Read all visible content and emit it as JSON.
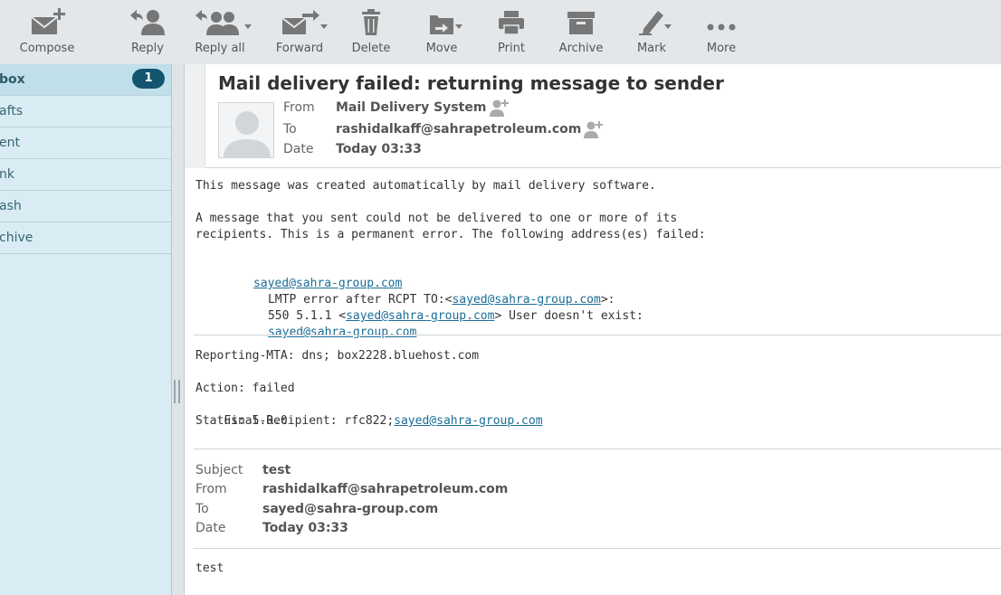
{
  "toolbar": {
    "compose": "Compose",
    "reply": "Reply",
    "reply_all": "Reply all",
    "forward": "Forward",
    "delete": "Delete",
    "move": "Move",
    "print": "Print",
    "archive": "Archive",
    "mark": "Mark",
    "more": "More"
  },
  "folders": [
    {
      "label": "box",
      "unread": "1",
      "selected": true
    },
    {
      "label": "afts"
    },
    {
      "label": "ent"
    },
    {
      "label": "nk"
    },
    {
      "label": "ash"
    },
    {
      "label": "chive"
    }
  ],
  "message": {
    "subject": "Mail delivery failed: returning message to sender",
    "from_label": "From",
    "from": "Mail Delivery System",
    "to_label": "To",
    "to": "rashidalkaff@sahrapetroleum.com",
    "date_label": "Date",
    "date": "Today 03:33"
  },
  "body": {
    "line1": "This message was created automatically by mail delivery software.",
    "line2": "A message that you sent could not be delivered to one or more of its",
    "line3": "recipients. This is a permanent error. The following address(es) failed:",
    "failed_address": "sayed@sahra-group.com",
    "lmtp_prefix": "LMTP error after RCPT TO:<",
    "lmtp_address": "sayed@sahra-group.com",
    "lmtp_suffix": ">:",
    "err_prefix": "550 5.1.1 <",
    "err_address": "sayed@sahra-group.com",
    "err_suffix": "> User doesn't exist:",
    "err_address2": "sayed@sahra-group.com",
    "reporting_mta": "Reporting-MTA: dns; box2228.bluehost.com",
    "action": "Action: failed",
    "final_recipient_prefix": "Final-Recipient: rfc822;",
    "final_recipient_address": "sayed@sahra-group.com",
    "status": "Status: 5.0.0"
  },
  "original": {
    "subject_label": "Subject",
    "subject": "test",
    "from_label": "From",
    "from": "rashidalkaff@sahrapetroleum.com",
    "to_label": "To",
    "to": "sayed@sahra-group.com",
    "date_label": "Date",
    "date": "Today 03:33",
    "body": "test"
  },
  "icons": {
    "compose": "envelope-plus-icon",
    "reply": "reply-person-icon",
    "reply_all": "reply-all-people-icon",
    "forward": "forward-envelope-icon",
    "delete": "trash-icon",
    "move": "folder-arrow-icon",
    "print": "printer-icon",
    "archive": "archive-box-icon",
    "mark": "pen-icon",
    "more": "dots-icon",
    "add_contact": "add-contact-icon",
    "avatar": "person-silhouette-icon"
  },
  "colors": {
    "icon": "#777777",
    "link": "#1b6d96",
    "badge": "#13556e",
    "folder_bg": "#d9ecf4",
    "selected_folder": "#c0dfeb"
  }
}
